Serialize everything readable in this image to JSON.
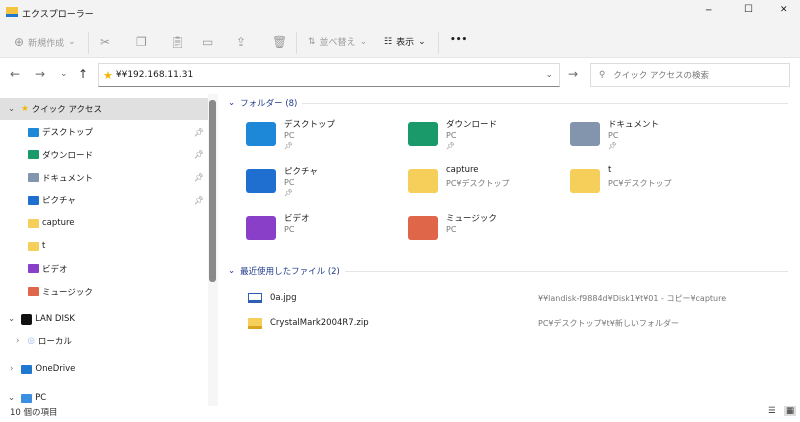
{
  "window": {
    "title": "エクスプローラー",
    "minimize": "─",
    "maximize": "☐",
    "close": "✕"
  },
  "toolbar": {
    "new": "新規作成",
    "sort": "並べ替え",
    "view": "表示",
    "more": "•••"
  },
  "address": {
    "path": "¥¥192.168.11.31",
    "search_placeholder": "クイック アクセスの検索"
  },
  "sidebar": {
    "quick_access": "クイック アクセス",
    "items": [
      {
        "label": "デスクトップ",
        "color": "#1e88d8",
        "pinned": true
      },
      {
        "label": "ダウンロード",
        "color": "#1a9a6a",
        "pinned": true
      },
      {
        "label": "ドキュメント",
        "color": "#8394ad",
        "pinned": true
      },
      {
        "label": "ピクチャ",
        "color": "#1e6fd0",
        "pinned": true
      },
      {
        "label": "capture",
        "color": "#f6cf5a",
        "pinned": false
      },
      {
        "label": "t",
        "color": "#f6cf5a",
        "pinned": false
      },
      {
        "label": "ビデオ",
        "color": "#8a3fc8",
        "pinned": false
      },
      {
        "label": "ミュージック",
        "color": "#e0664a",
        "pinned": false
      }
    ],
    "lan_disk": "LAN DISK",
    "local": "ローカル",
    "onedrive": "OneDrive",
    "pc": "PC"
  },
  "content": {
    "folders_header": "フォルダー (8)",
    "folders": [
      {
        "name": "デスクトップ",
        "sub": "PC",
        "pinned": true,
        "color": "#1e88d8"
      },
      {
        "name": "ダウンロード",
        "sub": "PC",
        "pinned": true,
        "color": "#1a9a6a"
      },
      {
        "name": "ドキュメント",
        "sub": "PC",
        "pinned": true,
        "color": "#8394ad"
      },
      {
        "name": "ピクチャ",
        "sub": "PC",
        "pinned": true,
        "color": "#1e6fd0"
      },
      {
        "name": "capture",
        "sub": "PC¥デスクトップ",
        "pinned": false,
        "color": "#f6cf5a"
      },
      {
        "name": "t",
        "sub": "PC¥デスクトップ",
        "pinned": false,
        "color": "#f6cf5a"
      },
      {
        "name": "ビデオ",
        "sub": "PC",
        "pinned": false,
        "color": "#8a3fc8"
      },
      {
        "name": "ミュージック",
        "sub": "PC",
        "pinned": false,
        "color": "#e0664a"
      }
    ],
    "recent_header": "最近使用したファイル (2)",
    "recent": [
      {
        "name": "0a.jpg",
        "path": "¥¥landisk-f9884d¥Disk1¥t¥01 - コピー¥capture"
      },
      {
        "name": "CrystalMark2004R7.zip",
        "path": "PC¥デスクトップ¥t¥新しいフォルダー"
      }
    ]
  },
  "status": {
    "count": "10 個の項目"
  }
}
